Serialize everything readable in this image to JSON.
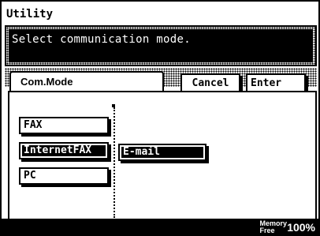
{
  "header": {
    "title": "Utility"
  },
  "message": {
    "text": "Select communication mode."
  },
  "tab": {
    "label": "Com.Mode"
  },
  "actions": {
    "cancel_label": "Cancel",
    "enter_label": "Enter"
  },
  "modes": {
    "fax": "FAX",
    "internet_fax": "InternetFAX",
    "pc": "PC",
    "selected": "InternetFAX"
  },
  "submodes": {
    "email": "E-mail"
  },
  "status": {
    "memory_label_line1": "Memory",
    "memory_label_line2": "Free",
    "memory_value": "100%"
  }
}
